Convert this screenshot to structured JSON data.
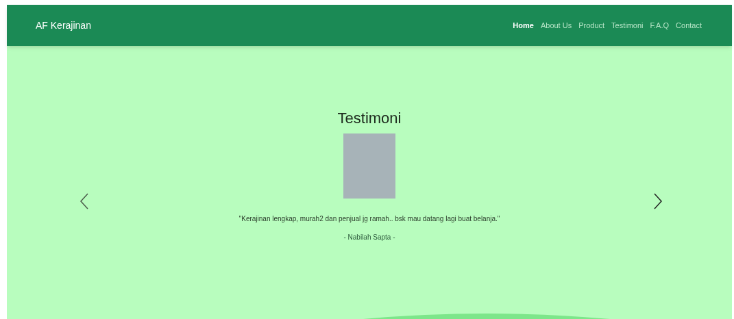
{
  "navbar": {
    "brand": "AF Kerajinan",
    "links": [
      {
        "label": "Home",
        "selected": true
      },
      {
        "label": "About Us",
        "selected": false
      },
      {
        "label": "Product",
        "selected": false
      },
      {
        "label": "Testimoni",
        "selected": false
      },
      {
        "label": "F.A.Q",
        "selected": false
      },
      {
        "label": "Contact",
        "selected": false
      }
    ]
  },
  "testimonial": {
    "heading": "Testimoni",
    "quote": "\"Kerajinan lengkap, murah2 dan penjual jg ramah.. bsk mau datang lagi buat belanja.\"",
    "author": "- Nabilah Sapta -"
  }
}
